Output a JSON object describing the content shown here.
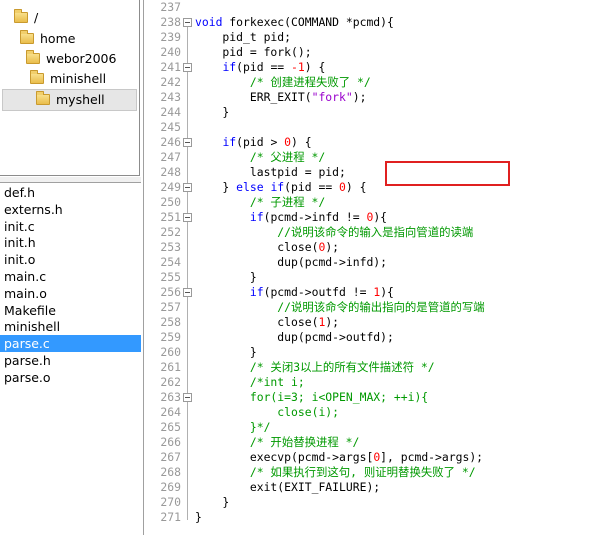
{
  "tree": {
    "items": [
      {
        "label": "/"
      },
      {
        "label": "home"
      },
      {
        "label": "webor2006"
      },
      {
        "label": "minishell"
      },
      {
        "label": "myshell",
        "selected": true
      }
    ]
  },
  "files": {
    "items": [
      {
        "label": "def.h"
      },
      {
        "label": "externs.h"
      },
      {
        "label": "init.c"
      },
      {
        "label": "init.h"
      },
      {
        "label": "init.o"
      },
      {
        "label": "main.c"
      },
      {
        "label": "main.o"
      },
      {
        "label": "Makefile"
      },
      {
        "label": "minishell"
      },
      {
        "label": "parse.c",
        "selected": true
      },
      {
        "label": "parse.h"
      },
      {
        "label": "parse.o"
      }
    ]
  },
  "editor": {
    "colors": {
      "keyword": "#0000ff",
      "number": "#ff0000",
      "string": "#9900cc",
      "comment": "#009900",
      "highlight_box": "#e02020"
    },
    "lines": [
      {
        "num": "237",
        "fold": false,
        "segs": []
      },
      {
        "num": "238",
        "fold": true,
        "segs": [
          {
            "t": "kw",
            "s": "void"
          },
          {
            "t": "",
            "s": " forkexec(COMMAND *pcmd){"
          }
        ]
      },
      {
        "num": "239",
        "fold": false,
        "segs": [
          {
            "t": "",
            "s": "    pid_t pid;"
          }
        ]
      },
      {
        "num": "240",
        "fold": false,
        "segs": [
          {
            "t": "",
            "s": "    pid = fork();"
          }
        ]
      },
      {
        "num": "241",
        "fold": true,
        "segs": [
          {
            "t": "",
            "s": "    "
          },
          {
            "t": "kw",
            "s": "if"
          },
          {
            "t": "",
            "s": "(pid == "
          },
          {
            "t": "num",
            "s": "-1"
          },
          {
            "t": "",
            "s": ") {"
          }
        ]
      },
      {
        "num": "242",
        "fold": false,
        "segs": [
          {
            "t": "cm",
            "s": "        /* 创建进程失败了 */"
          }
        ]
      },
      {
        "num": "243",
        "fold": false,
        "segs": [
          {
            "t": "",
            "s": "        ERR_EXIT("
          },
          {
            "t": "str",
            "s": "\"fork\""
          },
          {
            "t": "",
            "s": ");"
          }
        ]
      },
      {
        "num": "244",
        "fold": false,
        "segs": [
          {
            "t": "",
            "s": "    }"
          }
        ]
      },
      {
        "num": "245",
        "fold": false,
        "segs": []
      },
      {
        "num": "246",
        "fold": true,
        "segs": [
          {
            "t": "",
            "s": "    "
          },
          {
            "t": "kw",
            "s": "if"
          },
          {
            "t": "",
            "s": "(pid > "
          },
          {
            "t": "num",
            "s": "0"
          },
          {
            "t": "",
            "s": ") {"
          }
        ]
      },
      {
        "num": "247",
        "fold": false,
        "segs": [
          {
            "t": "cm",
            "s": "        /* 父进程 */"
          }
        ]
      },
      {
        "num": "248",
        "fold": false,
        "segs": [
          {
            "t": "",
            "s": "        lastpid = pid;"
          }
        ]
      },
      {
        "num": "249",
        "fold": true,
        "segs": [
          {
            "t": "",
            "s": "    } "
          },
          {
            "t": "kw",
            "s": "else if"
          },
          {
            "t": "",
            "s": "(pid == "
          },
          {
            "t": "num",
            "s": "0"
          },
          {
            "t": "",
            "s": ") {"
          }
        ]
      },
      {
        "num": "250",
        "fold": false,
        "segs": [
          {
            "t": "cm",
            "s": "        /* 子进程 */"
          }
        ]
      },
      {
        "num": "251",
        "fold": true,
        "segs": [
          {
            "t": "",
            "s": "        "
          },
          {
            "t": "kw",
            "s": "if"
          },
          {
            "t": "",
            "s": "(pcmd->infd != "
          },
          {
            "t": "num",
            "s": "0"
          },
          {
            "t": "",
            "s": "){"
          }
        ]
      },
      {
        "num": "252",
        "fold": false,
        "segs": [
          {
            "t": "cm",
            "s": "            //说明该命令的输入是指向管道的读端"
          }
        ]
      },
      {
        "num": "253",
        "fold": false,
        "segs": [
          {
            "t": "",
            "s": "            close("
          },
          {
            "t": "num",
            "s": "0"
          },
          {
            "t": "",
            "s": ");"
          }
        ]
      },
      {
        "num": "254",
        "fold": false,
        "segs": [
          {
            "t": "",
            "s": "            dup(pcmd->infd);"
          }
        ]
      },
      {
        "num": "255",
        "fold": false,
        "segs": [
          {
            "t": "",
            "s": "        }"
          }
        ]
      },
      {
        "num": "256",
        "fold": true,
        "segs": [
          {
            "t": "",
            "s": "        "
          },
          {
            "t": "kw",
            "s": "if"
          },
          {
            "t": "",
            "s": "(pcmd->outfd != "
          },
          {
            "t": "num",
            "s": "1"
          },
          {
            "t": "",
            "s": "){"
          }
        ]
      },
      {
        "num": "257",
        "fold": false,
        "segs": [
          {
            "t": "cm",
            "s": "            //说明该命令的输出指向的是管道的写端"
          }
        ]
      },
      {
        "num": "258",
        "fold": false,
        "segs": [
          {
            "t": "",
            "s": "            close("
          },
          {
            "t": "num",
            "s": "1"
          },
          {
            "t": "",
            "s": ");"
          }
        ]
      },
      {
        "num": "259",
        "fold": false,
        "segs": [
          {
            "t": "",
            "s": "            dup(pcmd->outfd);"
          }
        ]
      },
      {
        "num": "260",
        "fold": false,
        "segs": [
          {
            "t": "",
            "s": "        }"
          }
        ]
      },
      {
        "num": "261",
        "fold": false,
        "segs": [
          {
            "t": "cm",
            "s": "        /* 关闭3以上的所有文件描述符 */"
          }
        ]
      },
      {
        "num": "262",
        "fold": false,
        "segs": [
          {
            "t": "cm",
            "s": "        /*int i;"
          }
        ]
      },
      {
        "num": "263",
        "fold": true,
        "segs": [
          {
            "t": "cm",
            "s": "        for(i=3; i<OPEN_MAX; ++i){"
          }
        ]
      },
      {
        "num": "264",
        "fold": false,
        "segs": [
          {
            "t": "cm",
            "s": "            close(i);"
          }
        ]
      },
      {
        "num": "265",
        "fold": false,
        "segs": [
          {
            "t": "cm",
            "s": "        }*/"
          }
        ]
      },
      {
        "num": "266",
        "fold": false,
        "segs": [
          {
            "t": "cm",
            "s": "        /* 开始替换进程 */"
          }
        ]
      },
      {
        "num": "267",
        "fold": false,
        "segs": [
          {
            "t": "",
            "s": "        execvp(pcmd->args["
          },
          {
            "t": "num",
            "s": "0"
          },
          {
            "t": "",
            "s": "], pcmd->args);"
          }
        ]
      },
      {
        "num": "268",
        "fold": false,
        "segs": [
          {
            "t": "cm",
            "s": "        /* 如果执行到这句, 则证明替换失败了 */"
          }
        ]
      },
      {
        "num": "269",
        "fold": false,
        "segs": [
          {
            "t": "",
            "s": "        exit(EXIT_FAILURE);"
          }
        ]
      },
      {
        "num": "270",
        "fold": false,
        "segs": [
          {
            "t": "",
            "s": "    }"
          }
        ]
      },
      {
        "num": "271",
        "fold": false,
        "segs": [
          {
            "t": "",
            "s": "}"
          }
        ]
      }
    ]
  }
}
